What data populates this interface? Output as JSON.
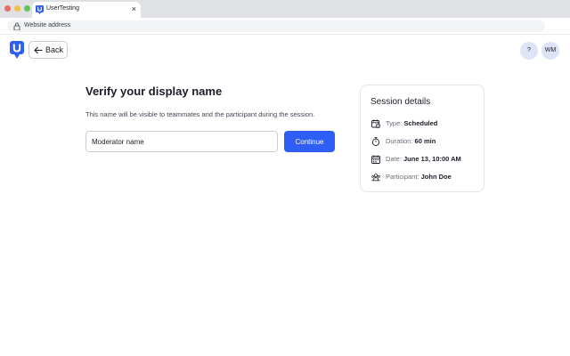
{
  "browser": {
    "tab_title": "UserTesting",
    "tab_close": "×",
    "address": "Website address"
  },
  "header": {
    "back_label": "Back",
    "help_label": "?",
    "avatar_initials": "WM"
  },
  "main": {
    "title": "Verify your display name",
    "description": "This name will be visible to teammates and the participant during the session.",
    "input_value": "Moderator name",
    "continue_label": "Continue"
  },
  "session": {
    "title": "Session details",
    "rows": [
      {
        "icon": "calendar-check-icon",
        "label": "Type: ",
        "value": "Scheduled"
      },
      {
        "icon": "stopwatch-icon",
        "label": "Duration: ",
        "value": "60 min"
      },
      {
        "icon": "calendar-icon",
        "label": "Date: ",
        "value": "June 13, 10:00 AM"
      },
      {
        "icon": "participant-icon",
        "label": "Participant: ",
        "value": "John Doe"
      }
    ]
  },
  "colors": {
    "accent": "#2f5ef5",
    "avatar_bg": "#dde4f7",
    "brand": "#2f5ef5"
  }
}
